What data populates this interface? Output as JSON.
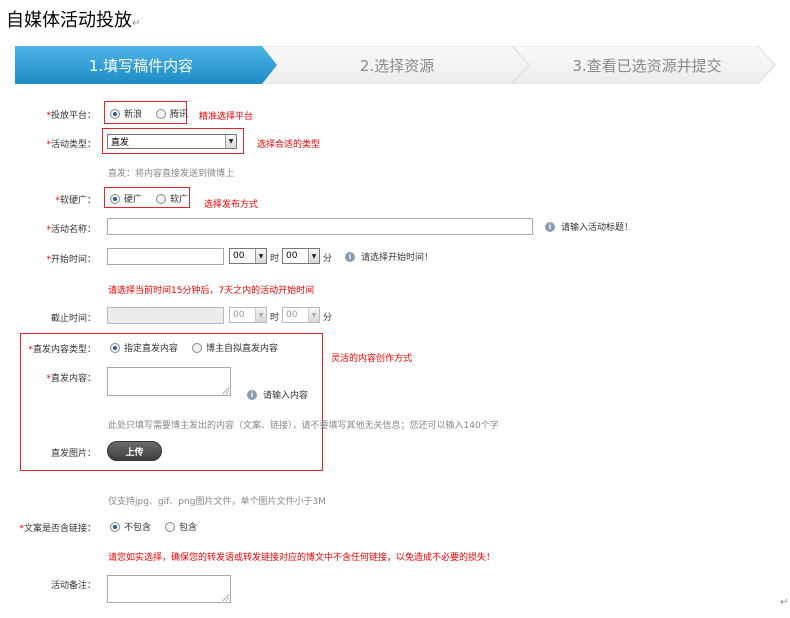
{
  "page": {
    "title": "自媒体活动投放",
    "return_mark": "↵"
  },
  "steps": [
    {
      "label": "1.填写稿件内容",
      "active": true
    },
    {
      "label": "2.选择资源",
      "active": false
    },
    {
      "label": "3.查看已选资源并提交",
      "active": false
    }
  ],
  "form": {
    "platform": {
      "label": "投放平台：",
      "options": [
        "新浪",
        "腾讯"
      ],
      "selected": "新浪",
      "annotation": "精准选择平台"
    },
    "activity_type": {
      "label": "活动类型：",
      "value": "直发",
      "annotation": "选择合适的类型",
      "hint": "直发：将内容直接发送到微博上"
    },
    "soft_hard": {
      "label": "软硬广：",
      "options": [
        "硬广",
        "软广"
      ],
      "selected": "硬广",
      "annotation": "选择发布方式"
    },
    "activity_name": {
      "label": "活动名称：",
      "value": "",
      "hint": "请输入活动标题！"
    },
    "start_time": {
      "label": "开始时间：",
      "hour": "00",
      "hour_unit": "时",
      "minute": "00",
      "minute_unit": "分",
      "hint": "请选择开始时间！",
      "note": "请选择当前时间15分钟后，7天之内的活动开始时间"
    },
    "end_time": {
      "label": "截止时间：",
      "hour": "00",
      "hour_unit": "时",
      "minute": "00",
      "minute_unit": "分"
    },
    "direct_content_type": {
      "label": "直发内容类型：",
      "options": [
        "指定直发内容",
        "博主自拟直发内容"
      ],
      "selected": "指定直发内容",
      "annotation": "灵活的内容创作方式"
    },
    "direct_content": {
      "label": "直发内容：",
      "hint": "请输入内容",
      "note": "此处只填写需要博主发出的内容（文案、链接），请不要填写其他无关信息；您还可以输入140个字"
    },
    "direct_image": {
      "label": "直发图片：",
      "button": "上传",
      "note": "仅支持jpg、gif、png图片文件，单个图片文件小于3M"
    },
    "contains_link": {
      "label": "文案是否含链接：",
      "options": [
        "不包含",
        "包含"
      ],
      "selected": "不包含",
      "note": "请您如实选择，确保您的转发语或转发链接对应的博文中不含任何链接，以免造成不必要的损失！"
    },
    "remarks": {
      "label": "活动备注："
    }
  },
  "colors": {
    "accent": "#2a9fd6",
    "annotation": "#e0262a",
    "inactive_step": "#f2f2f2"
  }
}
